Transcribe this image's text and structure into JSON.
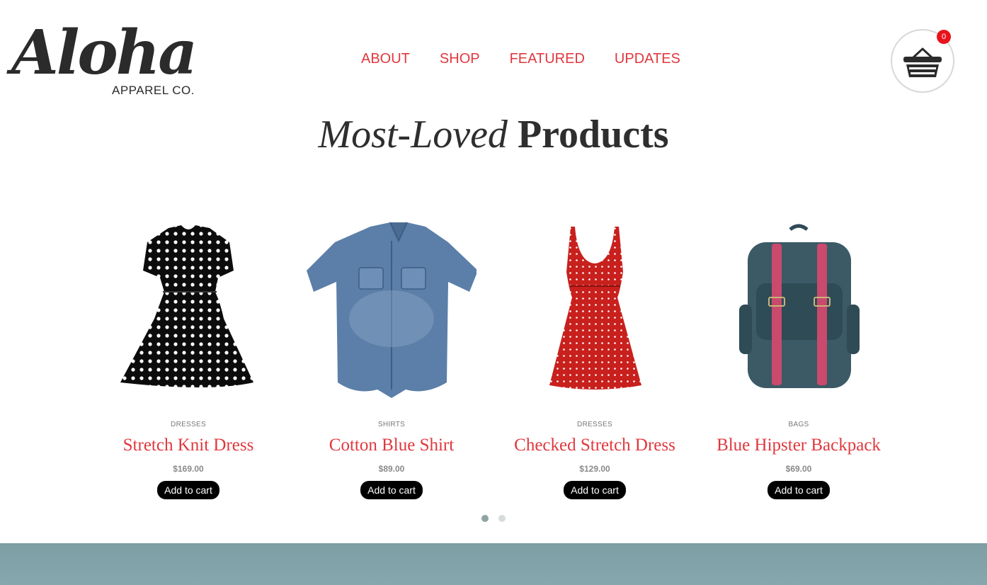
{
  "logo": {
    "script": "Aloha",
    "sub": "APPAREL CO."
  },
  "nav": [
    "ABOUT",
    "SHOP",
    "FEATURED",
    "UPDATES"
  ],
  "cart": {
    "count": "0",
    "icon": "basket-icon"
  },
  "headline": {
    "italic": "Most-Loved",
    "bold": "Products"
  },
  "products": [
    {
      "category": "DRESSES",
      "name": "Stretch Knit Dress",
      "price": "$169.00",
      "button": "Add to cart"
    },
    {
      "category": "SHIRTS",
      "name": "Cotton Blue Shirt",
      "price": "$89.00",
      "button": "Add to cart"
    },
    {
      "category": "DRESSES",
      "name": "Checked Stretch Dress",
      "price": "$129.00",
      "button": "Add to cart"
    },
    {
      "category": "BAGS",
      "name": "Blue Hipster Backpack",
      "price": "$69.00",
      "button": "Add to cart"
    }
  ],
  "carousel": {
    "pages": 2,
    "active": 1
  },
  "colors": {
    "accent": "#e0383e",
    "text": "#2e2e2e",
    "badge": "#e8131c"
  }
}
